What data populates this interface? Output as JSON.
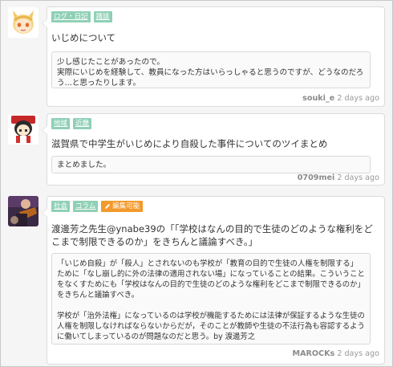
{
  "posts": [
    {
      "avatar": "cat-ears-girl-avatar",
      "tags": [
        "ログ・日記",
        "雑談"
      ],
      "title": "いじめについて",
      "body": "少し感じたことがあったので。\n実際にいじめを経験して、教員になった方はいらっしゃると思うのですが、どうなのだろう...と思ったりします。",
      "user": "souki_e",
      "time": "2 days ago"
    },
    {
      "avatar": "shrine-maiden-avatar",
      "tags": [
        "地域",
        "近畿"
      ],
      "title": "滋賀県で中学生がいじめにより自殺した事件についてのツイまとめ",
      "body": "まとめました。",
      "user": "0709mei",
      "time": "2 days ago"
    },
    {
      "avatar": "guitarist-photo-avatar",
      "tags": [
        "社会",
        "コラム"
      ],
      "editable": "編集可能",
      "title": "渡邊芳之先生@ynabe39の「「学校はなんの目的で生徒のどのような権利をどこまで制限できるのか」をきちんと議論すべき。」",
      "body": "「いじめ自殺」が「殺人」とされないのも学校が「教育の目的で生徒の人権を制限する」ために「なし崩し的に外の法律の適用されない場」になっていることの結果。こういうことをなくすためにも「学校はなんの目的で生徒のどのような権利をどこまで制限できるのか」をきちんと議論すべき。\n\n学校が「治外法権」になっているのは学校が機能するためには法律が保証するような生徒の人権を制限しなければならないからだが，そのことが教師や生徒の不法行為も容認するように働いてしまっているのが問題なのだと思う。by 渡邊芳之",
      "user": "MAROCKs",
      "time": "2 days ago"
    }
  ],
  "colors": {
    "tag": "#8fd0b6",
    "edit_tag": "#f39a2c",
    "meta": "#999999"
  }
}
